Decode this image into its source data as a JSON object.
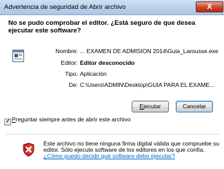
{
  "window": {
    "title": "Advertencia de seguridad de Abrir archivo",
    "close_label": "X"
  },
  "heading": "No se pudo comprobar el editor. ¿Está seguro de que desea ejecutar este software?",
  "details": [
    {
      "label": "Nombre:",
      "value": "... EXAMEN DE ADMISION 2014\\Guia_Larousse.exe",
      "bold": false
    },
    {
      "label": "Editor:",
      "value": "Editor desconocido",
      "bold": true
    },
    {
      "label": "Tipo:",
      "value": "Aplicación",
      "bold": false
    },
    {
      "label": "De:",
      "value": "C:\\Users\\ADMIN\\Desktop\\GUIA PARA EL EXAME...",
      "bold": false
    }
  ],
  "buttons": {
    "run": {
      "mnemonic": "E",
      "rest": "jecutar"
    },
    "cancel": "Cancelar"
  },
  "checkbox": {
    "mnemonic": "P",
    "rest": "reguntar siempre antes de abrir este archivo",
    "checked": true
  },
  "warning": {
    "text": "Este archivo no tiene ninguna firma digital válida que compruebe su editor. Sólo ejecute software de los editores en los que confía.",
    "link": "¿Cómo puedo decidir qué software debo ejecutar?"
  },
  "icons": {
    "file": "application-file-icon",
    "shield": "security-shield-icon"
  }
}
